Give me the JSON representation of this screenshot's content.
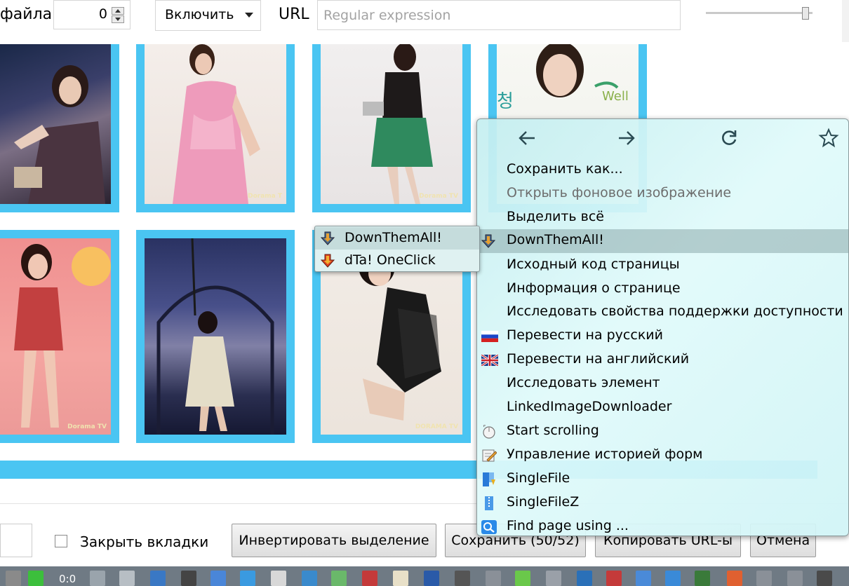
{
  "toolbar": {
    "file_label_partial": "файла",
    "spinner_value": "0",
    "select_value": "Включить",
    "url_label": "URL",
    "url_placeholder": "Regular expression"
  },
  "gallery": {
    "watermark": "Dorama TV",
    "watermark_short": "Dorama T",
    "watermark_2": "DORAMA TV"
  },
  "bottom": {
    "close_tabs_label": "Закрыть вкладки",
    "invert_button": "Инвертировать выделение",
    "save_button": "Сохранить (50/52)",
    "copy_urls_button": "Копировать URL-ы",
    "cancel_button": "Отмена"
  },
  "taskbar": {
    "counter": "0:0"
  },
  "context_menu": {
    "items": [
      {
        "label": "Сохранить как...",
        "access": "х",
        "disabled": false
      },
      {
        "label": "Открыть фоновое изображение",
        "access": "ы",
        "disabled": true
      },
      {
        "label": "Выделить всё",
        "disabled": false
      },
      {
        "label": "DownThemAll!",
        "disabled": false,
        "selected": true,
        "icon": "downthemall-icon"
      },
      {
        "label": "Исходный код страницы",
        "disabled": false
      },
      {
        "label": "Информация о странице",
        "disabled": false
      },
      {
        "label": "Исследовать свойства поддержки доступности",
        "disabled": false
      },
      {
        "label": "Перевести на русский",
        "disabled": false,
        "icon": "russian-flag-icon"
      },
      {
        "label": "Перевести на английский",
        "disabled": false,
        "icon": "uk-flag-icon"
      },
      {
        "label": "Исследовать элемент",
        "disabled": false
      },
      {
        "label": "LinkedImageDownloader",
        "disabled": false
      },
      {
        "label": "Start scrolling",
        "disabled": false,
        "icon": "mouse-icon"
      },
      {
        "label": "Управление историей форм",
        "disabled": false,
        "icon": "form-history-icon"
      },
      {
        "label": "SingleFile",
        "disabled": false,
        "icon": "singlefile-icon"
      },
      {
        "label": "SingleFileZ",
        "disabled": false,
        "icon": "singlefilez-icon"
      },
      {
        "label": "Find page using ...",
        "disabled": false,
        "icon": "magnifier-icon"
      }
    ]
  },
  "submenu": {
    "items": [
      {
        "label": "DownThemAll!",
        "icon": "downthemall-icon"
      },
      {
        "label": "dTa! OneClick",
        "icon": "dta-oneclick-icon"
      }
    ]
  }
}
